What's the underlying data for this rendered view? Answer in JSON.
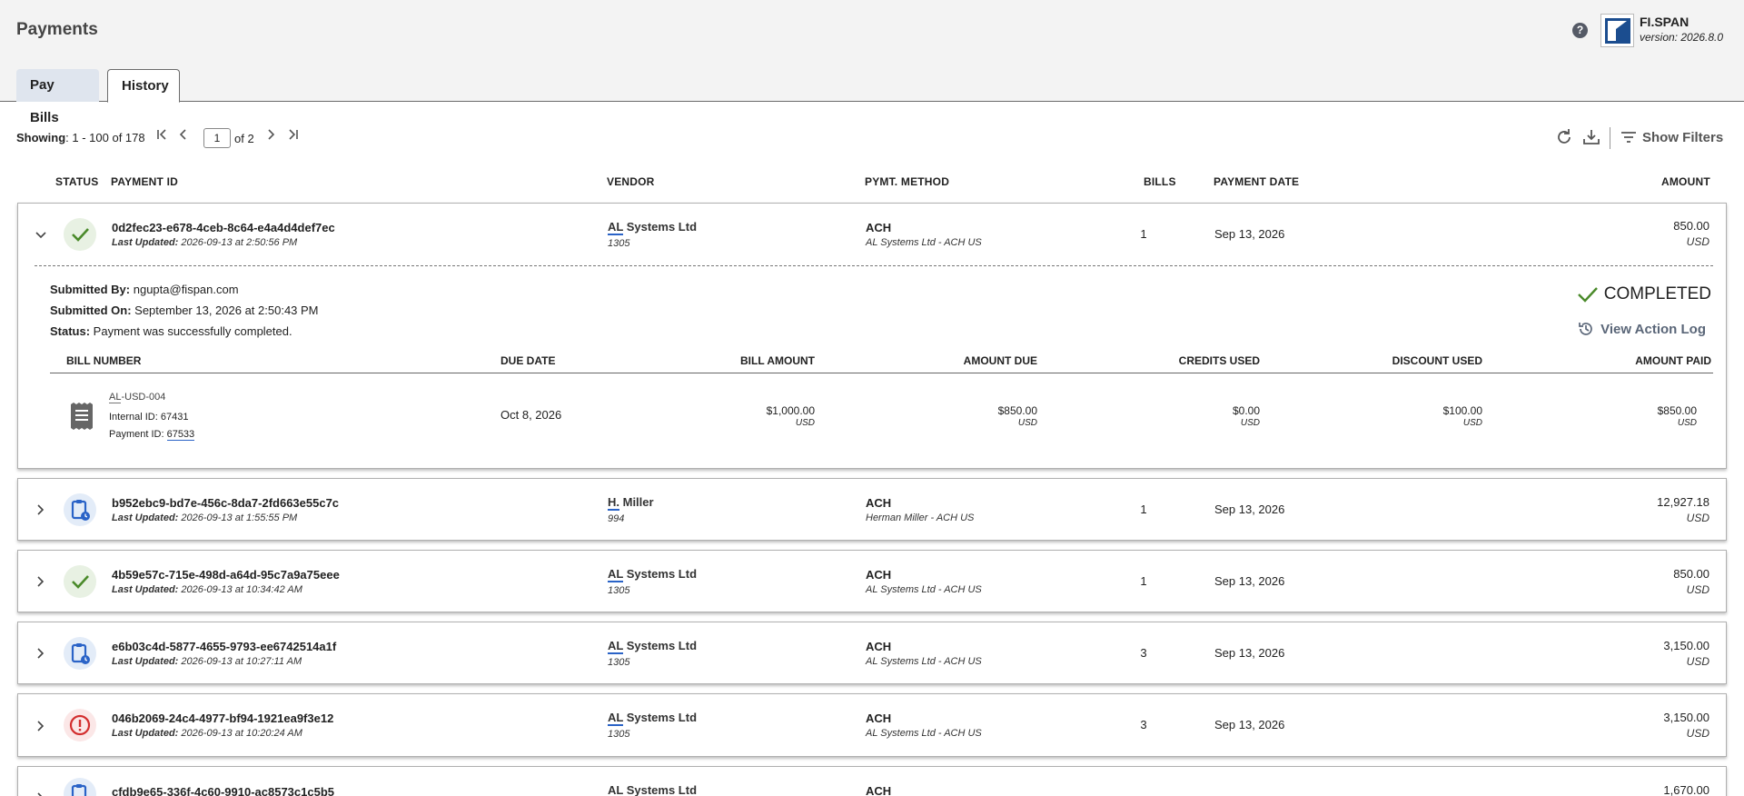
{
  "header": {
    "title": "Payments",
    "brand_name": "FI.SPAN",
    "brand_version": "version: 2026.8.0",
    "help_icon": "help-circle-icon"
  },
  "tabs": [
    {
      "label": "Pay Bills",
      "active": false
    },
    {
      "label": "History",
      "active": true
    }
  ],
  "toolbar": {
    "showing_label": "Showing",
    "showing_range": ": 1 - 100 of 178",
    "page_value": "1",
    "of_total": "of 2",
    "show_filters_label": "Show Filters"
  },
  "columns": {
    "status": "STATUS",
    "payment_id": "PAYMENT ID",
    "vendor": "VENDOR",
    "method": "PYMT. METHOD",
    "bills": "BILLS",
    "payment_date": "PAYMENT DATE",
    "amount": "AMOUNT"
  },
  "colors": {
    "success": "#4a8a2a",
    "pending": "#2a63c7",
    "error": "#d32f2f"
  },
  "payments": [
    {
      "status": "completed",
      "payment_id": "0d2fec23-e678-4ceb-8c64-e4a4d4def7ec",
      "last_updated_label": "Last Updated:",
      "last_updated": " 2026-09-13 at 2:50:56 PM",
      "vendor_abbr": "AL",
      "vendor_rest": " Systems Ltd",
      "vendor_id": "1305",
      "method": "ACH",
      "method_sub": "AL Systems Ltd - ACH US",
      "bills": "1",
      "date": "Sep 13, 2026",
      "amount": "850.00",
      "currency": "USD",
      "expanded": true
    },
    {
      "status": "pending",
      "payment_id": "b952ebc9-bd7e-456c-8da7-2fd663e55c7c",
      "last_updated_label": "Last Updated:",
      "last_updated": " 2026-09-13 at 1:55:55 PM",
      "vendor_abbr": "H.",
      "vendor_rest": " Miller",
      "vendor_id": "994",
      "method": "ACH",
      "method_sub": "Herman Miller - ACH US",
      "bills": "1",
      "date": "Sep 13, 2026",
      "amount": "12,927.18",
      "currency": "USD"
    },
    {
      "status": "completed",
      "payment_id": "4b59e57c-715e-498d-a64d-95c7a9a75eee",
      "last_updated_label": "Last Updated:",
      "last_updated": " 2026-09-13 at 10:34:42 AM",
      "vendor_abbr": "AL",
      "vendor_rest": " Systems Ltd",
      "vendor_id": "1305",
      "method": "ACH",
      "method_sub": "AL Systems Ltd - ACH US",
      "bills": "1",
      "date": "Sep 13, 2026",
      "amount": "850.00",
      "currency": "USD"
    },
    {
      "status": "pending",
      "payment_id": "e6b03c4d-5877-4655-9793-ee6742514a1f",
      "last_updated_label": "Last Updated:",
      "last_updated": " 2026-09-13 at 10:27:11 AM",
      "vendor_abbr": "AL",
      "vendor_rest": " Systems Ltd",
      "vendor_id": "1305",
      "method": "ACH",
      "method_sub": "AL Systems Ltd - ACH US",
      "bills": "3",
      "date": "Sep 13, 2026",
      "amount": "3,150.00",
      "currency": "USD"
    },
    {
      "status": "error",
      "payment_id": "046b2069-24c4-4977-bf94-1921ea9f3e12",
      "last_updated_label": "Last Updated:",
      "last_updated": " 2026-09-13 at 10:20:24 AM",
      "vendor_abbr": "AL",
      "vendor_rest": " Systems Ltd",
      "vendor_id": "1305",
      "method": "ACH",
      "method_sub": "AL Systems Ltd - ACH US",
      "bills": "3",
      "date": "Sep 13, 2026",
      "amount": "3,150.00",
      "currency": "USD"
    },
    {
      "status": "pending",
      "payment_id": "cfdb9e65-336f-4c60-9910-ac8573c1c5b5",
      "vendor_abbr": "AL",
      "vendor_rest": " Systems Ltd",
      "method": "ACH",
      "amount": "1,670.00"
    }
  ],
  "detail": {
    "submitted_by_label": "Submitted By:",
    "submitted_by": " ngupta@fispan.com",
    "submitted_on_label": "Submitted On:",
    "submitted_on": " September 13, 2026 at 2:50:43 PM",
    "status_label": "Status:",
    "status_text": " Payment was successfully completed.",
    "status_badge": "COMPLETED",
    "view_action_log": "View Action Log",
    "bill_columns": {
      "bill_number": "BILL NUMBER",
      "due_date": "DUE DATE",
      "bill_amount": "BILL AMOUNT",
      "amount_due": "AMOUNT DUE",
      "credits_used": "CREDITS USED",
      "discount_used": "DISCOUNT USED",
      "amount_paid": "AMOUNT PAID"
    },
    "bill": {
      "number_abbr": "AL",
      "number_rest": "-USD-004",
      "internal_id": "Internal ID: 67431",
      "payment_id_label": "Payment ID: ",
      "payment_id": "67533",
      "due_date": "Oct 8, 2026",
      "bill_amount": "$1,000.00",
      "amount_due": "$850.00",
      "credits_used": "$0.00",
      "discount_used": "$100.00",
      "amount_paid": "$850.00",
      "currency": "USD"
    }
  }
}
